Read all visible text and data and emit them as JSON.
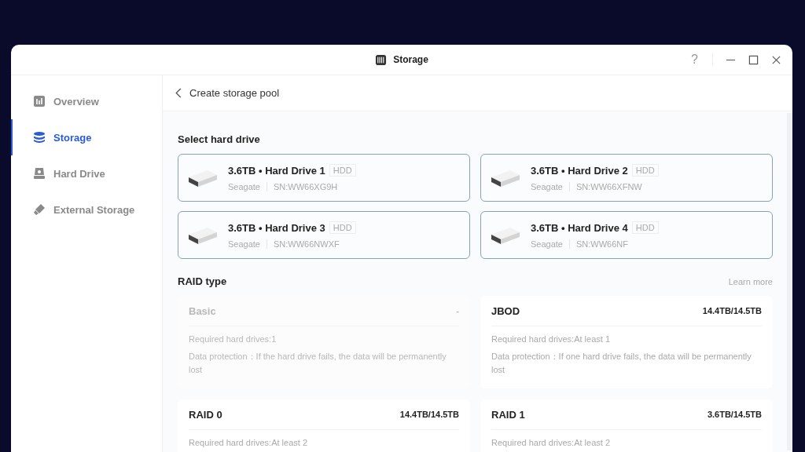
{
  "window": {
    "title": "Storage",
    "controls": [
      "?"
    ]
  },
  "sidebar": {
    "items": [
      {
        "label": "Overview",
        "kind": "overview",
        "selected": false
      },
      {
        "label": "Storage",
        "kind": "storage",
        "selected": true
      },
      {
        "label": "Hard Drive",
        "kind": "drive",
        "selected": false
      },
      {
        "label": "External Storage",
        "kind": "external",
        "selected": false
      }
    ]
  },
  "header": {
    "title": "Create storage pool"
  },
  "drives_section": {
    "title": "Select hard drive"
  },
  "drives": [
    {
      "name": "3.6TB • Hard Drive 1",
      "type": "HDD",
      "brand": "Seagate",
      "serial": "SN:WW66XG9H",
      "selected": true
    },
    {
      "name": "3.6TB • Hard Drive 2",
      "type": "HDD",
      "brand": "Seagate",
      "serial": "SN:WW66XFNW",
      "selected": true
    },
    {
      "name": "3.6TB • Hard Drive 3",
      "type": "HDD",
      "brand": "Seagate",
      "serial": "SN:WW66NWXF",
      "selected": true
    },
    {
      "name": "3.6TB • Hard Drive 4",
      "type": "HDD",
      "brand": "Seagate",
      "serial": "SN:WW66NF",
      "selected": true
    }
  ],
  "raid_section": {
    "title": "RAID type",
    "link": "Learn more"
  },
  "raid_types": [
    {
      "name": "Basic",
      "capacity": "-",
      "required": "Required hard drives:1",
      "protection": "Data protection：If the hard drive fails, the data will be permanently lost",
      "disabled": true
    },
    {
      "name": "JBOD",
      "capacity": "14.4TB/14.5TB",
      "required": "Required hard drives:At least 1",
      "protection": "Data protection：If one hard drive fails, the data will be permanently lost",
      "disabled": false
    },
    {
      "name": "RAID 0",
      "capacity": "14.4TB/14.5TB",
      "required": "Required hard drives:At least 2",
      "disabled": false
    },
    {
      "name": "RAID 1",
      "capacity": "3.6TB/14.5TB",
      "required": "Required hard drives:At least 2",
      "disabled": false
    }
  ]
}
